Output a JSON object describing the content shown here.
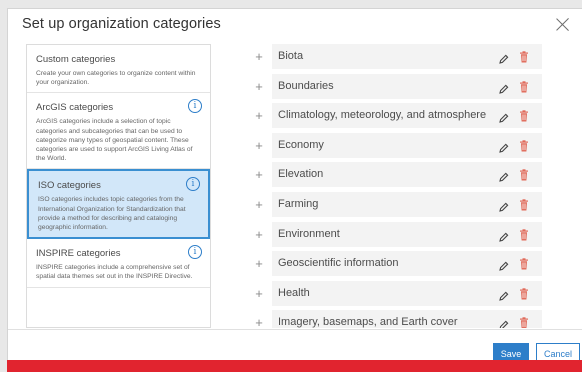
{
  "dialog": {
    "title": "Set up organization categories"
  },
  "left_cards": [
    {
      "title": "Custom categories",
      "desc": "Create your own categories to organize content within your organization.",
      "has_info": false,
      "selected": false
    },
    {
      "title": "ArcGIS categories",
      "desc": "ArcGIS categories include a selection of topic categories and subcategories that can be used to categorize many types of geospatial content. These categories are used to support ArcGIS Living Atlas of the World.",
      "has_info": true,
      "selected": false
    },
    {
      "title": "ISO categories",
      "desc": "ISO categories includes topic categories from the International Organization for Standardization that provide a method for describing and cataloging geographic information.",
      "has_info": true,
      "selected": true
    },
    {
      "title": "INSPIRE categories",
      "desc": "INSPIRE categories include a comprehensive set of spatial data themes set out in the INSPIRE Directive.",
      "has_info": true,
      "selected": false
    }
  ],
  "categories": [
    "Biota",
    "Boundaries",
    "Climatology, meteorology, and atmosphere",
    "Economy",
    "Elevation",
    "Farming",
    "Environment",
    "Geoscientific information",
    "Health",
    "Imagery, basemaps, and Earth cover"
  ],
  "footer": {
    "save_label": "Save",
    "cancel_label": "Cancel"
  },
  "icons": {
    "expand": "plus-icon",
    "edit": "pencil-icon",
    "delete": "trash-icon",
    "info": "info-icon",
    "close": "close-icon"
  },
  "colors": {
    "accent": "#2d7ec9",
    "selected_bg": "#d2e7f9",
    "delete": "#e06a5a",
    "footer_bar": "#e1242f"
  }
}
